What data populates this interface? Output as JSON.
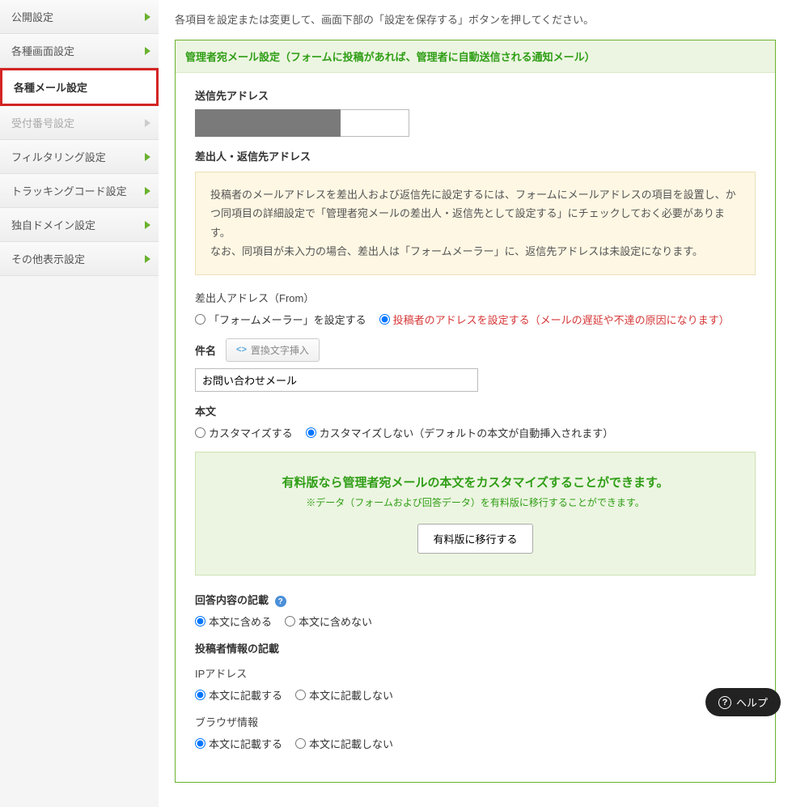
{
  "sidebar": {
    "items": [
      {
        "label": "公開設定",
        "state": "normal"
      },
      {
        "label": "各種画面設定",
        "state": "normal"
      },
      {
        "label": "各種メール設定",
        "state": "active"
      },
      {
        "label": "受付番号設定",
        "state": "disabled"
      },
      {
        "label": "フィルタリング設定",
        "state": "normal"
      },
      {
        "label": "トラッキングコード設定",
        "state": "normal"
      },
      {
        "label": "独自ドメイン設定",
        "state": "normal"
      },
      {
        "label": "その他表示設定",
        "state": "normal"
      }
    ]
  },
  "intro": "各項目を設定または変更して、画面下部の「設定を保存する」ボタンを押してください。",
  "section": {
    "header": "管理者宛メール設定（フォームに投稿があれば、管理者に自動送信される通知メール）",
    "send_to_label": "送信先アドレス",
    "from_reply_label": "差出人・返信先アドレス",
    "notice_line1": "投稿者のメールアドレスを差出人および返信先に設定するには、フォームにメールアドレスの項目を設置し、かつ同項目の詳細設定で「管理者宛メールの差出人・返信先として設定する」にチェックしておく必要があります。",
    "notice_line2": "なお、同項目が未入力の場合、差出人は「フォームメーラー」に、返信先アドレスは未設定になります。",
    "from_addr_label": "差出人アドレス（From）",
    "from_opts": {
      "a": "「フォームメーラー」を設定する",
      "b": "投稿者のアドレスを設定する（メールの遅延や不達の原因になります）"
    },
    "subject_label": "件名",
    "insert_btn": "置換文字挿入",
    "subject_value": "お問い合わせメール",
    "body_label": "本文",
    "body_opts": {
      "a": "カスタマイズする",
      "b": "カスタマイズしない（デフォルトの本文が自動挿入されます）"
    },
    "promo": {
      "title": "有料版なら管理者宛メールの本文をカスタマイズすることができます。",
      "sub": "※データ（フォームおよび回答データ）を有料版に移行することができます。",
      "btn": "有料版に移行する"
    },
    "answer_label": "回答内容の記載",
    "answer_opts": {
      "a": "本文に含める",
      "b": "本文に含めない"
    },
    "poster_label": "投稿者情報の記載",
    "ip_label": "IPアドレス",
    "ip_opts": {
      "a": "本文に記載する",
      "b": "本文に記載しない"
    },
    "browser_label": "ブラウザ情報",
    "browser_opts": {
      "a": "本文に記載する",
      "b": "本文に記載しない"
    }
  },
  "help_float": "ヘルプ"
}
